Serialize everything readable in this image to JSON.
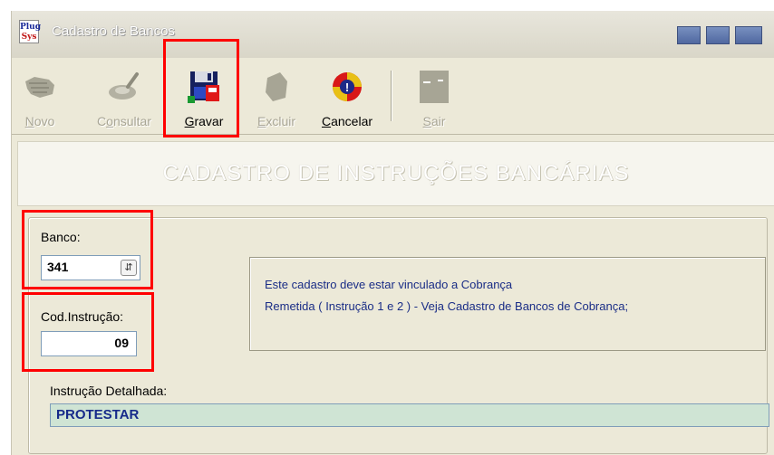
{
  "window": {
    "app_logo_line1": "Plug",
    "app_logo_line2": "Sys",
    "title": "Cadastro de Bancos"
  },
  "toolbar": {
    "items": [
      {
        "label_accel": "N",
        "label_rest": "ovo",
        "icon": "hand-new-icon",
        "enabled": false
      },
      {
        "label_accel": "",
        "label_pre": "C",
        "label_ul": "o",
        "label_rest": "nsultar",
        "icon": "magnifier-consult-icon",
        "enabled": false
      },
      {
        "label_accel": "G",
        "label_rest": "ravar",
        "icon": "floppy-save-icon",
        "enabled": true
      },
      {
        "label_accel": "E",
        "label_rest": "xcluir",
        "icon": "delete-icon",
        "enabled": false
      },
      {
        "label_accel": "C",
        "label_rest": "ancelar",
        "icon": "cancel-refresh-icon",
        "enabled": true
      },
      {
        "label_accel": "S",
        "label_rest": "air",
        "icon": "exit-door-icon",
        "enabled": false
      }
    ]
  },
  "banner": {
    "title": "CADASTRO DE INSTRUÇÕES BANCÁRIAS"
  },
  "form": {
    "banco_label": "Banco:",
    "banco_value": "341",
    "cod_label": "Cod.Instrução:",
    "cod_value": "09",
    "detail_label": "Instrução Detalhada:",
    "detail_value": "PROTESTAR"
  },
  "info": {
    "line1": "Este cadastro deve estar vinculado a Cobrança",
    "line2": "Remetida ( Instrução 1 e 2 ) - Veja Cadastro de Bancos de Cobrança;"
  },
  "colors": {
    "window_bg": "#ece9d8",
    "highlight": "#ff0000",
    "info_text": "#1a2d86",
    "detail_bg": "#cfe4d4"
  }
}
